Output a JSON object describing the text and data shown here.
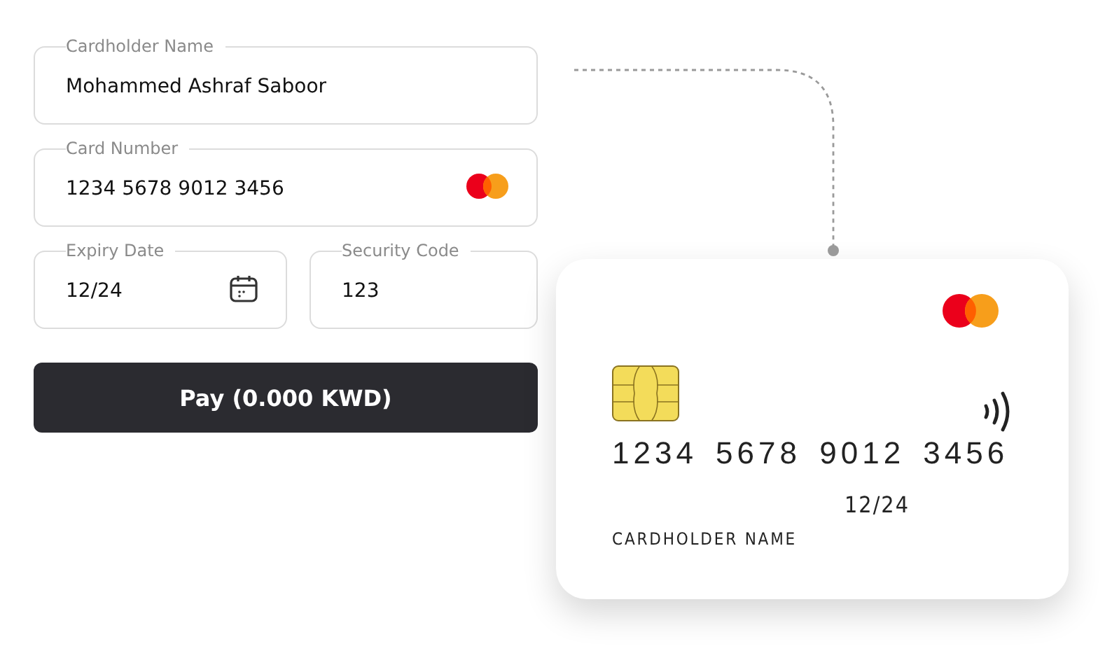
{
  "form": {
    "fields": [
      {
        "kind": "text",
        "label": "Cardholder Name",
        "value": "Mohammed Ashraf Saboor"
      },
      {
        "kind": "card",
        "label": "Card Number",
        "value": "1234 5678 9012 3456"
      },
      {
        "kind": "date",
        "label": "Expiry Date",
        "value": "12/24"
      },
      {
        "kind": "text",
        "label": "Security Code",
        "value": "123"
      }
    ],
    "pay_button": "Pay (0.000 KWD)"
  },
  "card": {
    "number": "1234 5678 9012 3456",
    "expiry": "12/24",
    "holder": "CARDHOLDER NAME"
  }
}
